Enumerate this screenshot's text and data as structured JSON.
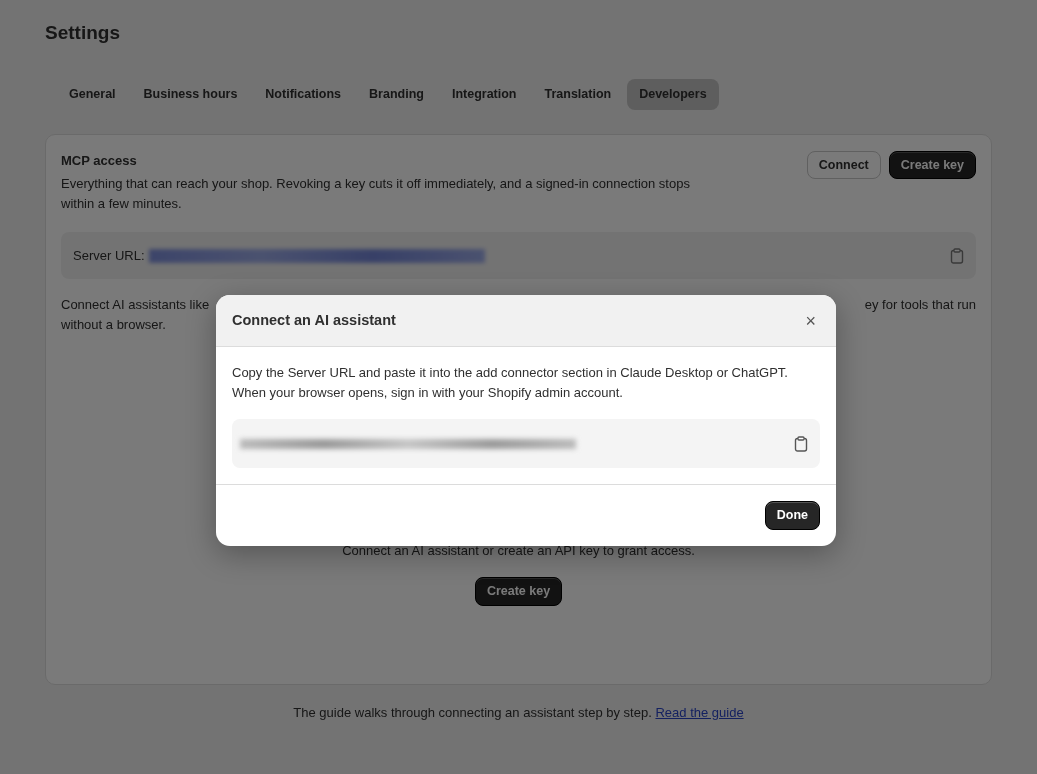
{
  "page": {
    "title": "Settings"
  },
  "tabs": [
    {
      "label": "General",
      "selected": false
    },
    {
      "label": "Business hours",
      "selected": false
    },
    {
      "label": "Notifications",
      "selected": false
    },
    {
      "label": "Branding",
      "selected": false
    },
    {
      "label": "Integration",
      "selected": false
    },
    {
      "label": "Translation",
      "selected": false
    },
    {
      "label": "Developers",
      "selected": true
    }
  ],
  "card": {
    "title": "MCP access",
    "description": "Everything that can reach your shop. Revoking a key cuts it off immediately, and a signed-in connection stops within a few minutes.",
    "buttons": [
      {
        "label": "Connect",
        "kind": "secondary"
      },
      {
        "label": "Create key",
        "kind": "primary"
      }
    ],
    "server_url": {
      "label": "Server URL:"
    },
    "intro_left": [
      "Connect AI assistants like",
      "without a browser."
    ],
    "intro_right": "ey for tools that run",
    "empty_state": {
      "text": "Connect an AI assistant or create an API key to grant access.",
      "button": "Create key"
    }
  },
  "footer": {
    "text": "The guide walks through connecting an assistant step by step.",
    "link": "Read the guide"
  },
  "dialog": {
    "title": "Connect an AI assistant",
    "close": "×",
    "body": [
      "Copy the Server URL and paste it into the add connector section in Claude Desktop or ChatGPT.",
      "When your browser opens, sign in with your Shopify admin account."
    ],
    "done": "Done"
  }
}
